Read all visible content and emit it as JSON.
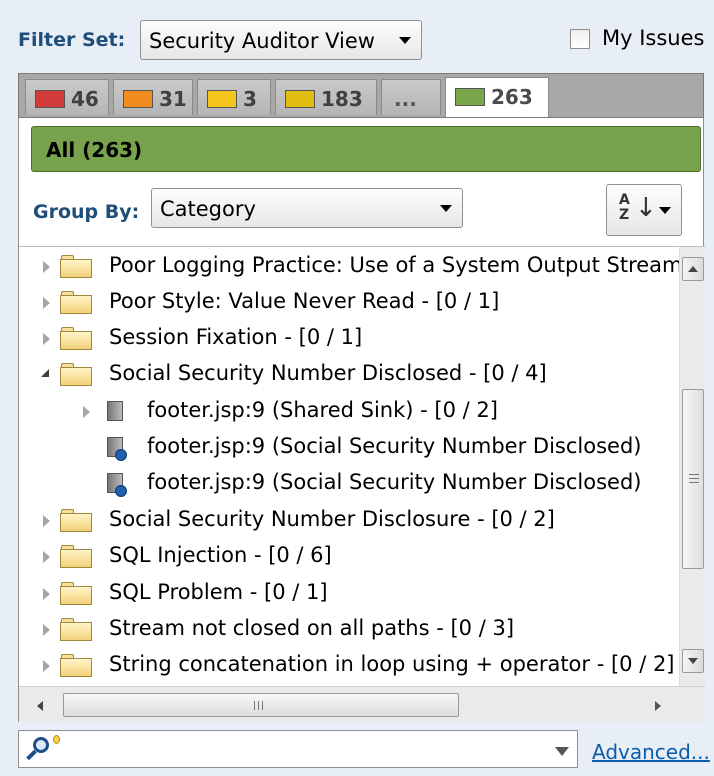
{
  "filter_set": {
    "label": "Filter Set:",
    "value": "Security Auditor View"
  },
  "my_issues": {
    "label": "My Issues",
    "checked": false
  },
  "priority_tabs": [
    {
      "count": "46",
      "color": "#d33a3a"
    },
    {
      "count": "31",
      "color": "#f08c1e"
    },
    {
      "count": "3",
      "color": "#f4c51a"
    },
    {
      "count": "183",
      "color": "#e2bc10"
    },
    {
      "count": "..."
    },
    {
      "count": "263",
      "color": "#7aa74b",
      "active": true
    }
  ],
  "all_bar": {
    "label": "All (263)",
    "color": "#79a24c"
  },
  "group_by": {
    "label": "Group By:",
    "value": "Category"
  },
  "sort_button": {
    "icon": "sort-az-icon",
    "az": "A\nZ"
  },
  "tree": [
    {
      "label": "Poor Logging Practice: Use of a System Output Stream",
      "type": "folder",
      "expanded": false,
      "level": 0
    },
    {
      "label": "Poor Style: Value Never Read - [0 / 1]",
      "type": "folder",
      "expanded": false,
      "level": 0
    },
    {
      "label": "Session Fixation - [0 / 1]",
      "type": "folder",
      "expanded": false,
      "level": 0
    },
    {
      "label": "Social Security Number Disclosed - [0 / 4]",
      "type": "folder",
      "expanded": true,
      "level": 0
    },
    {
      "label": "footer.jsp:9 (Shared Sink) - [0 / 2]",
      "type": "sink",
      "expanded": false,
      "level": 1
    },
    {
      "label": "footer.jsp:9 (Social Security Number Disclosed)",
      "type": "issue",
      "level": 1
    },
    {
      "label": "footer.jsp:9 (Social Security Number Disclosed)",
      "type": "issue",
      "level": 1
    },
    {
      "label": "Social Security Number Disclosure - [0 / 2]",
      "type": "folder",
      "expanded": false,
      "level": 0
    },
    {
      "label": "SQL Injection - [0 / 6]",
      "type": "folder",
      "expanded": false,
      "level": 0
    },
    {
      "label": "SQL Problem - [0 / 1]",
      "type": "folder",
      "expanded": false,
      "level": 0
    },
    {
      "label": "Stream not closed on all paths - [0 / 3]",
      "type": "folder",
      "expanded": false,
      "level": 0
    },
    {
      "label": "String concatenation in loop using + operator - [0 / 2]",
      "type": "folder",
      "expanded": false,
      "level": 0
    }
  ],
  "scrollbar": {
    "grip": "≡",
    "h_grip": "III"
  },
  "search": {
    "icon": "search-lens-icon",
    "value": ""
  },
  "advanced_link": "Advanced..."
}
